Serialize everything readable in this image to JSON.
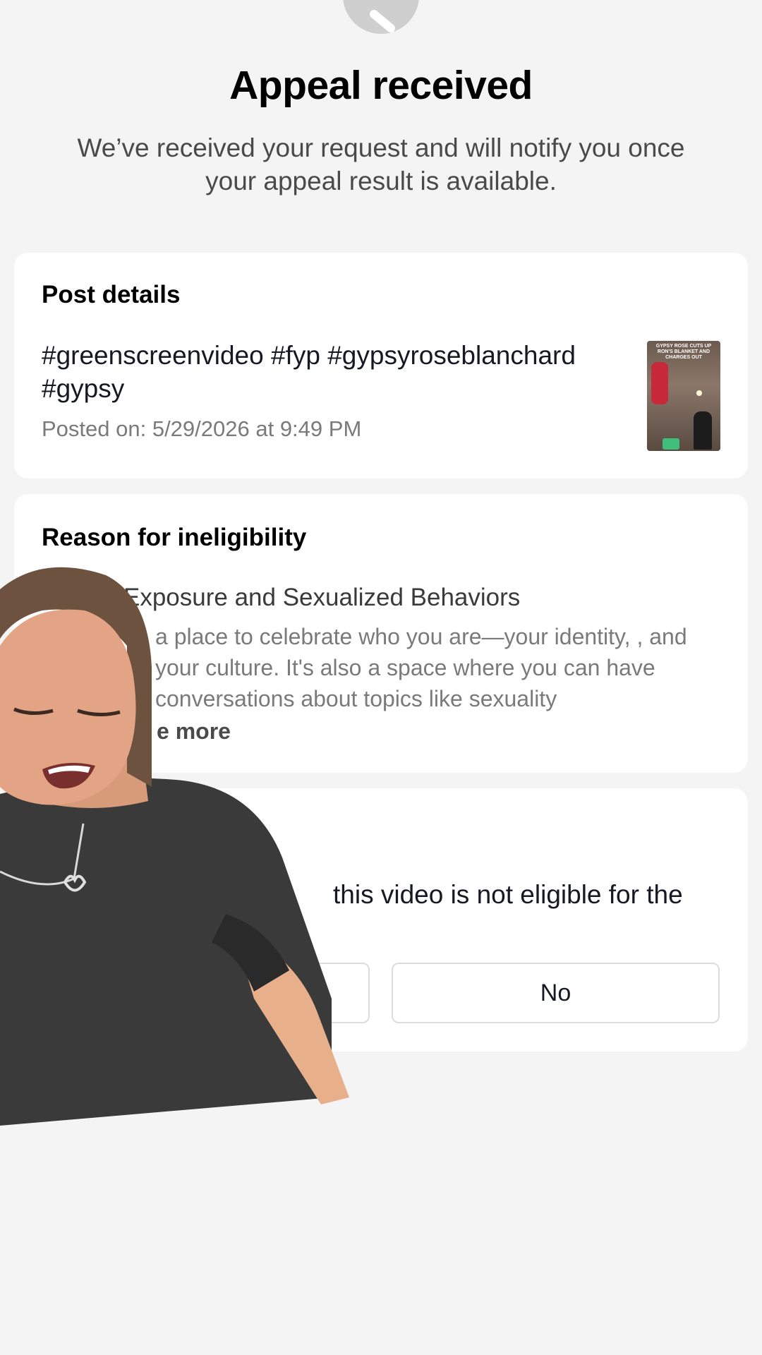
{
  "header": {
    "title": "Appeal received",
    "subtitle": "We’ve received your request and will notify you once your appeal result is available."
  },
  "post_details": {
    "heading": "Post details",
    "hashtags": "#greenscreenvideo #fyp #gypsyroseblanchard #gypsy",
    "posted_on": "Posted on: 5/29/2026 at 9:49 PM",
    "thumbnail_caption": "GYPSY ROSE CUTS UP RON'S BLANKET AND CHARGES OUT"
  },
  "reason": {
    "heading": "Reason for ineligibility",
    "title": "Exposure and Sexualized Behaviors",
    "body": "a place to celebrate who you are—your identity, , and your culture. It's also a space where you can have conversations about topics like sexuality",
    "see_more": "e more"
  },
  "question": {
    "text": "this video is not eligible for the",
    "no_label": "No",
    "yes_label": ""
  },
  "colors": {
    "background": "#f4f4f4",
    "card": "#ffffff",
    "title": "#000000",
    "muted": "#7a7a7a"
  },
  "icons": {
    "top": "status-icon",
    "thumbnail": "video-thumbnail"
  }
}
